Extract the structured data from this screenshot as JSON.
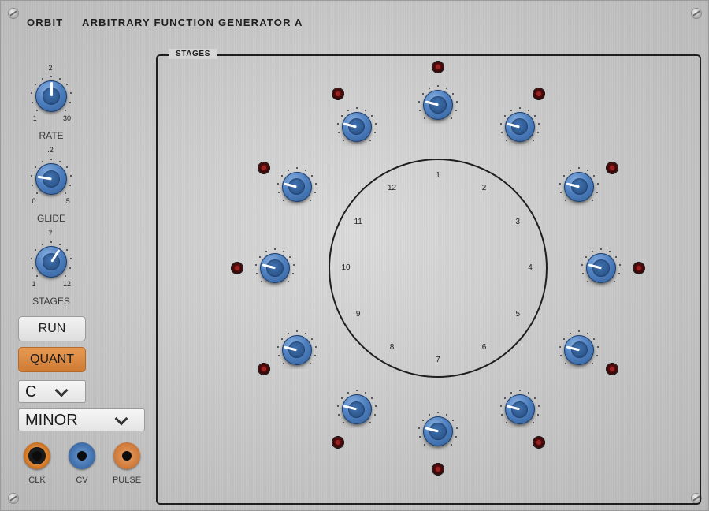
{
  "header": {
    "brand": "ORBIT",
    "title": "ARBITRARY FUNCTION GENERATOR A"
  },
  "controls": {
    "rate": {
      "label": "RATE",
      "value": "2",
      "min": ".1",
      "max": "30",
      "pointer_fraction": 0.5
    },
    "glide": {
      "label": "GLIDE",
      "value": ".2",
      "min": "0",
      "max": ".5",
      "pointer_fraction": 0.2
    },
    "stages": {
      "label": "STAGES",
      "value": "7",
      "min": "1",
      "max": "12",
      "pointer_fraction": 0.62
    }
  },
  "buttons": {
    "run": {
      "label": "RUN",
      "active": false
    },
    "quant": {
      "label": "QUANT",
      "active": true
    }
  },
  "selects": {
    "key": {
      "value": "C"
    },
    "scale": {
      "value": "MINOR"
    }
  },
  "jacks": [
    {
      "label": "CLK",
      "kind": "clk"
    },
    {
      "label": "CV",
      "kind": "cv"
    },
    {
      "label": "PULSE",
      "kind": "pulse"
    }
  ],
  "stages_panel": {
    "title": "STAGES",
    "ring_numbers": [
      "1",
      "2",
      "3",
      "4",
      "5",
      "6",
      "7",
      "8",
      "9",
      "10",
      "11",
      "12"
    ],
    "knob_fractions": [
      0.22,
      0.22,
      0.22,
      0.22,
      0.22,
      0.22,
      0.22,
      0.22,
      0.22,
      0.22,
      0.22,
      0.22
    ]
  },
  "colors": {
    "knob": "#4e7fbf",
    "quant_active": "#d98540",
    "led_off": "#5a0c0c",
    "panel": "#c9c9c9"
  }
}
